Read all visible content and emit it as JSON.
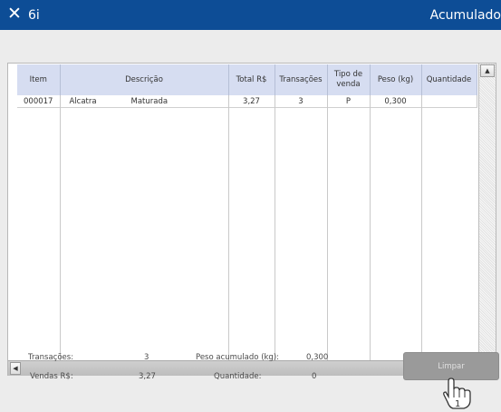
{
  "window": {
    "title": "6i",
    "right_title": "Acumulado",
    "close_glyph": "✕"
  },
  "table": {
    "columns": [
      "Item",
      "Descrição",
      "Total R$",
      "Transações",
      "Tipo de\nvenda",
      "Peso (kg)",
      "Quantidade"
    ],
    "rows": [
      {
        "item": "000017",
        "desc_name": "Alcatra",
        "desc_detail": "Maturada",
        "total": "3,27",
        "transacoes": "3",
        "tipo": "P",
        "peso": "0,300",
        "quantidade": ""
      }
    ]
  },
  "summary": {
    "transacoes_label": "Transações:",
    "transacoes_value": "3",
    "vendas_label": "Vendas R$:",
    "vendas_value": "3,27",
    "peso_label": "Peso acumulado (kg):",
    "peso_value": "0,300",
    "quantidade_label": "Quantidade:",
    "quantidade_value": "0"
  },
  "buttons": {
    "limpar": "Limpar"
  },
  "cursor": {
    "badge": "1",
    "icon": "hand-pointer-icon"
  },
  "scroll": {
    "up_glyph": "▲",
    "down_glyph": "▼",
    "left_glyph": "◀",
    "right_glyph": "▶"
  },
  "colors": {
    "titlebar": "#0d4d96",
    "header": "#d6ddf1",
    "panel": "#ececec",
    "button": "#9a9a9a"
  }
}
